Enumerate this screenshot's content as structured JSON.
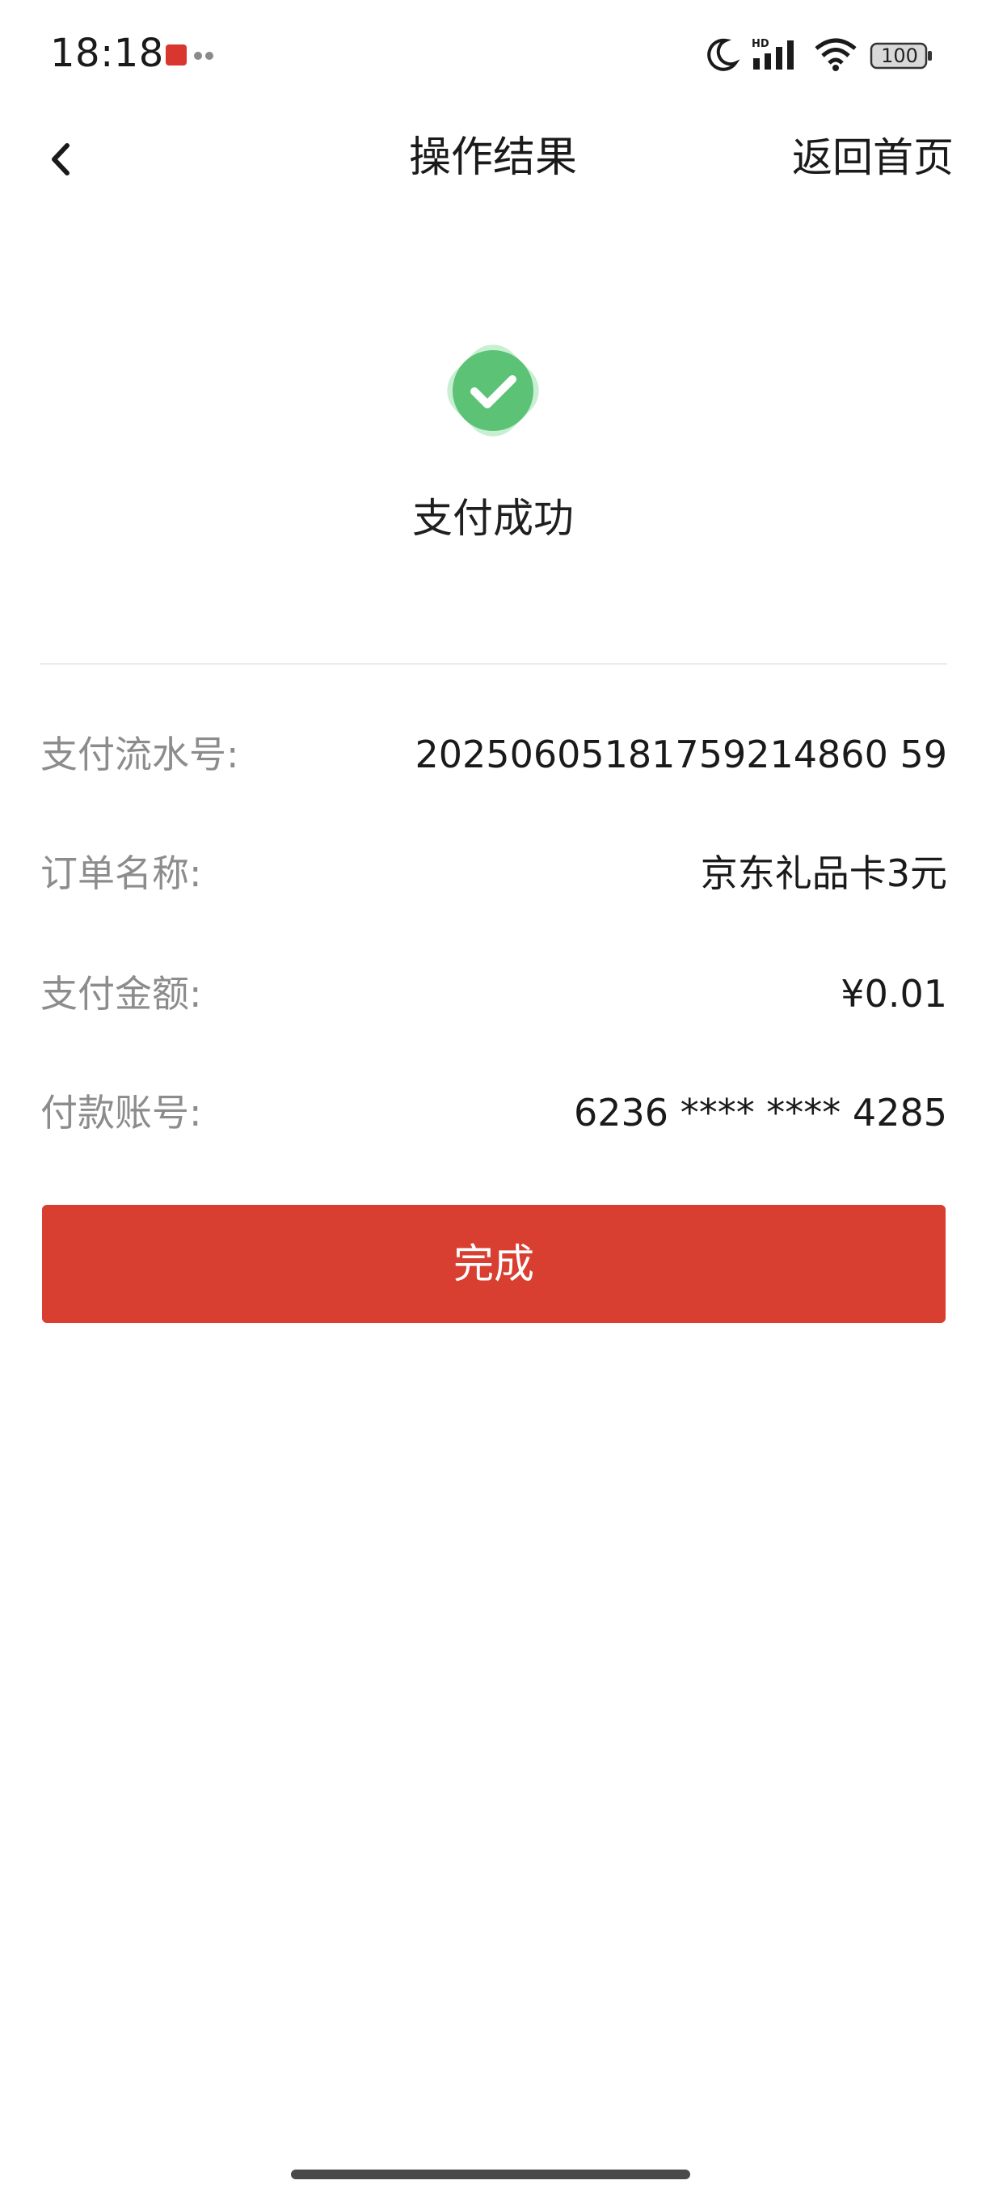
{
  "status_bar": {
    "time": "18:18",
    "battery": "100"
  },
  "nav": {
    "title": "操作结果",
    "home_label": "返回首页"
  },
  "result": {
    "message": "支付成功",
    "accent_color": "#5cc276"
  },
  "details": [
    {
      "label": "支付流水号:",
      "value": "20250605181759214860 59"
    },
    {
      "label": "订单名称:",
      "value": "京东礼品卡3元"
    },
    {
      "label": "支付金额:",
      "value": "¥0.01"
    },
    {
      "label": "付款账号:",
      "value": "6236 **** **** 4285"
    }
  ],
  "done_button": {
    "label": "完成",
    "color": "#d93f31"
  }
}
